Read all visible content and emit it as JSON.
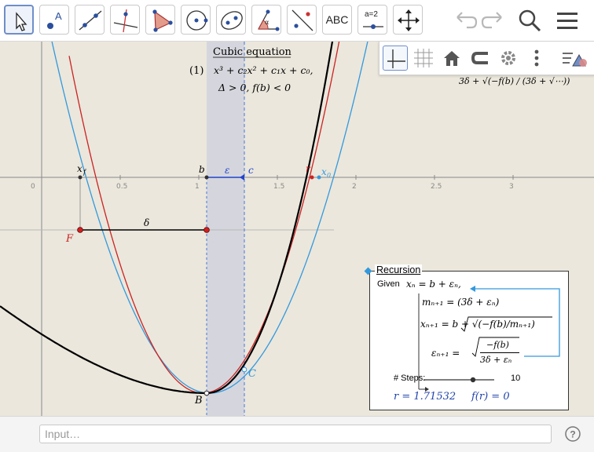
{
  "toolbar": {
    "tools": [
      {
        "name": "move"
      },
      {
        "name": "point",
        "label": "A"
      },
      {
        "name": "line"
      },
      {
        "name": "perpendicular-line"
      },
      {
        "name": "polygon"
      },
      {
        "name": "circle-center-point"
      },
      {
        "name": "ellipse"
      },
      {
        "name": "angle",
        "label": "α"
      },
      {
        "name": "reflect-about-line"
      },
      {
        "name": "text",
        "label": "ABC"
      },
      {
        "name": "slider",
        "label": "a=2"
      },
      {
        "name": "move-graphics-view"
      }
    ]
  },
  "header_icons": [
    "undo-icon",
    "redo-icon",
    "search-icon",
    "menu-icon"
  ],
  "stylebar_icons": [
    "axes-icon",
    "grid-icon",
    "home-icon",
    "point-capturing-icon",
    "settings-icon",
    "more-icon",
    "style-icon"
  ],
  "graph": {
    "x_ticks": [
      "0",
      "0.5",
      "1",
      "1.5",
      "2",
      "2.5",
      "3"
    ],
    "points": {
      "xf": "x",
      "xf_sub": "f",
      "b": "b",
      "epsilon": "ε",
      "c": "c",
      "r": "r",
      "x0": "x",
      "x0_sub": "0",
      "F": "F",
      "delta": "δ",
      "B": "B",
      "C": "C"
    },
    "colors": {
      "black_curve": "#000000",
      "red_curve": "#cc2222",
      "blue_curve": "#3399dd",
      "strip": "#c8ccdd",
      "dashed_blue": "#4477dd"
    }
  },
  "cubic": {
    "title": "Cubic equation",
    "eq_number": "(1)",
    "equation": "x³ + c₂x² + c₁x + c₀,",
    "conditions": "Δ > 0,   f(b) < 0"
  },
  "partial_formula": "3δ + √(−f(b) / (3δ + √⋯))",
  "recursion": {
    "title": "Recursion",
    "given": "Given",
    "line0": "xₙ = b + εₙ,",
    "line1": "mₙ₊₁ = (3δ + εₙ)",
    "line2": "xₙ₊₁ = b + √(−f(b)/mₙ₊₁)",
    "line3": "εₙ₊₁ =",
    "line3_num": "−f(b)",
    "line3_den": "3δ + εₙ",
    "steps_label": "# Steps:",
    "steps_value": "10",
    "result_r": "r = 1.71532",
    "result_f": "f(r) = 0"
  },
  "input": {
    "placeholder": "Input…"
  }
}
